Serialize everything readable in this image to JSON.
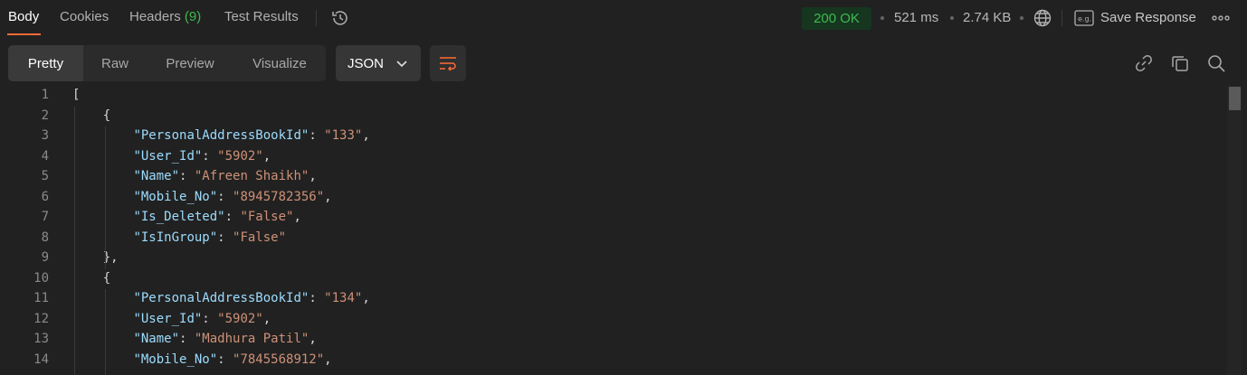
{
  "tabs": [
    {
      "label": "Body"
    },
    {
      "label": "Cookies"
    },
    {
      "label": "Headers",
      "count": "(9)"
    },
    {
      "label": "Test Results"
    }
  ],
  "status": {
    "code_text": "200 OK",
    "time": "521 ms",
    "size": "2.74 KB",
    "save_label": "Save Response"
  },
  "view_modes": [
    "Pretty",
    "Raw",
    "Preview",
    "Visualize"
  ],
  "format": "JSON",
  "colors": {
    "accent": "#ff6c37",
    "status_ok": "#3fb950",
    "key": "#9cdcfe",
    "string": "#ce9178"
  },
  "lines": [
    {
      "n": "1",
      "text": "["
    },
    {
      "n": "2",
      "text": "{"
    },
    {
      "n": "3",
      "key": "PersonalAddressBookId",
      "value": "133",
      "comma": true
    },
    {
      "n": "4",
      "key": "User_Id",
      "value": "5902",
      "comma": true
    },
    {
      "n": "5",
      "key": "Name",
      "value": "Afreen Shaikh",
      "comma": true
    },
    {
      "n": "6",
      "key": "Mobile_No",
      "value": "8945782356",
      "comma": true
    },
    {
      "n": "7",
      "key": "Is_Deleted",
      "value": "False",
      "comma": true
    },
    {
      "n": "8",
      "key": "IsInGroup",
      "value": "False",
      "comma": false
    },
    {
      "n": "9",
      "text": "},"
    },
    {
      "n": "10",
      "text": "{"
    },
    {
      "n": "11",
      "key": "PersonalAddressBookId",
      "value": "134",
      "comma": true
    },
    {
      "n": "12",
      "key": "User_Id",
      "value": "5902",
      "comma": true
    },
    {
      "n": "13",
      "key": "Name",
      "value": "Madhura Patil",
      "comma": true
    },
    {
      "n": "14",
      "key": "Mobile_No",
      "value": "7845568912",
      "comma": true
    }
  ]
}
